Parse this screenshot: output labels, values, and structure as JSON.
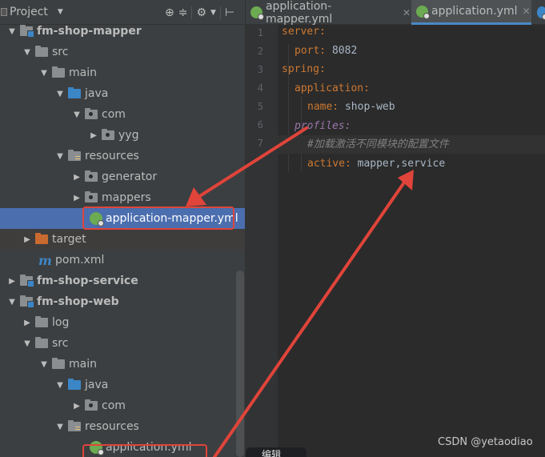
{
  "project_panel": {
    "title": "Project",
    "tree": [
      {
        "label": "fm-shop-mapper",
        "kind": "module",
        "bold": true
      },
      {
        "label": "src",
        "kind": "folder"
      },
      {
        "label": "main",
        "kind": "folder"
      },
      {
        "label": "java",
        "kind": "source"
      },
      {
        "label": "com",
        "kind": "package"
      },
      {
        "label": "yyg",
        "kind": "package"
      },
      {
        "label": "resources",
        "kind": "resources"
      },
      {
        "label": "generator",
        "kind": "folder"
      },
      {
        "label": "mappers",
        "kind": "folder"
      },
      {
        "label": "application-mapper.yml",
        "kind": "yml",
        "selected": true
      },
      {
        "label": "target",
        "kind": "excluded"
      },
      {
        "label": "pom.xml",
        "kind": "maven"
      },
      {
        "label": "fm-shop-service",
        "kind": "module",
        "bold": true
      },
      {
        "label": "fm-shop-web",
        "kind": "module",
        "bold": true
      },
      {
        "label": "log",
        "kind": "folder"
      },
      {
        "label": "src",
        "kind": "folder"
      },
      {
        "label": "main",
        "kind": "folder"
      },
      {
        "label": "java",
        "kind": "source"
      },
      {
        "label": "com",
        "kind": "package"
      },
      {
        "label": "resources",
        "kind": "resources"
      },
      {
        "label": "application.yml",
        "kind": "yml"
      }
    ]
  },
  "editor": {
    "tabs": [
      {
        "label": "application-mapper.yml",
        "active": false
      },
      {
        "label": "application.yml",
        "active": true
      }
    ],
    "line_numbers": [
      "1",
      "2",
      "3",
      "4",
      "5",
      "6",
      "7"
    ],
    "code": {
      "server": "server:",
      "port_key": "port:",
      "port_val": " 8082",
      "spring": "spring:",
      "application": "application:",
      "name_key": "name:",
      "name_val": " shop-web",
      "profiles": "profiles:",
      "comment": "#加载激活不同模块的配置文件",
      "active_key": "active:",
      "active_val": " mapper,service"
    }
  },
  "tooltip": "编辑",
  "watermark": "CSDN @yetaodiao",
  "colors": {
    "annotation": "#e0443a",
    "selection": "#4b6eaf",
    "keyword": "#cc7832"
  }
}
